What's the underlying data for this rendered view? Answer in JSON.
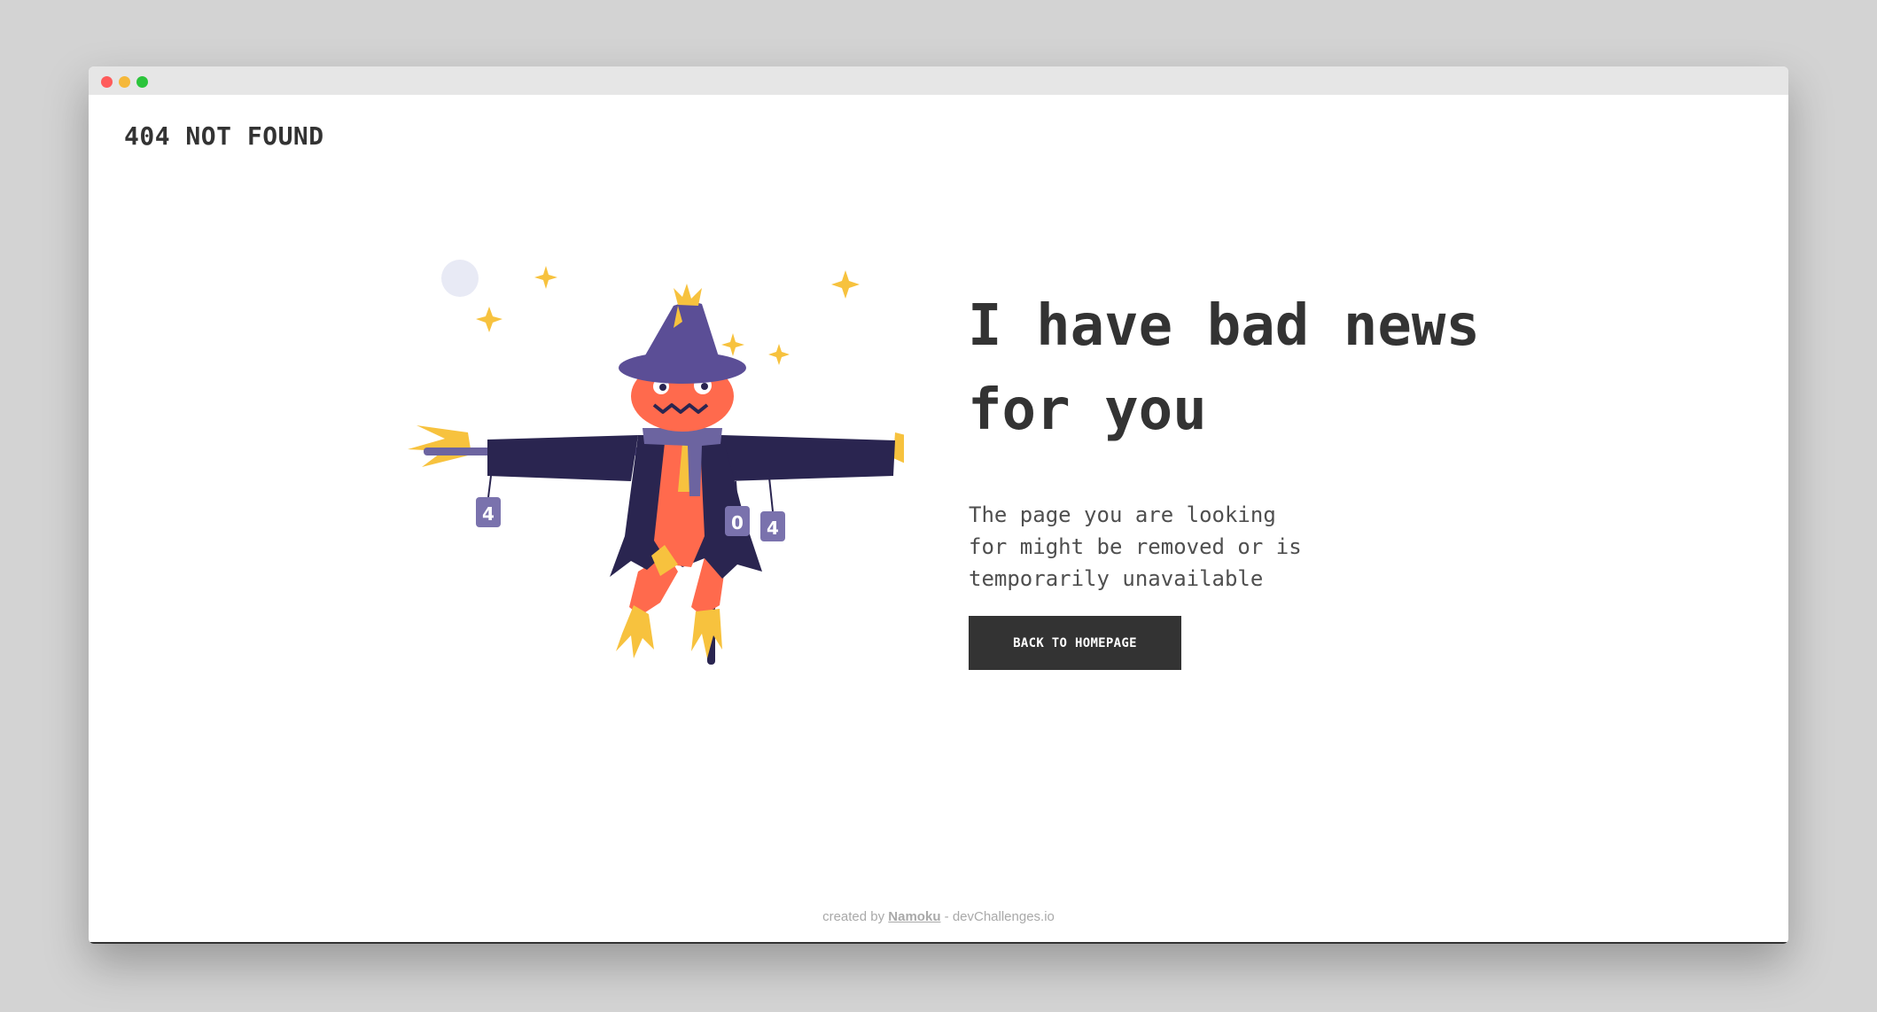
{
  "header": {
    "logo": "404 NOT FOUND"
  },
  "main": {
    "headline_line1": "I have bad news",
    "headline_line2": "for you",
    "message_line1": "The page you are looking",
    "message_line2": "for might be removed or is",
    "message_line3": "temporarily unavailable",
    "button_label": "BACK TO HOMEPAGE"
  },
  "illustration": {
    "can_labels": [
      "4",
      "0",
      "4"
    ],
    "colors": {
      "hat": "#5b4e96",
      "coat": "#2a2550",
      "face": "#ff6a4d",
      "straw": "#f7c23e",
      "scarf": "#6c64a0",
      "can": "#7a72ad",
      "moon": "#e8eaf5",
      "post": "#2a2550"
    }
  },
  "footer": {
    "prefix": "created by",
    "author": "Namoku",
    "suffix": "- devChallenges.io"
  },
  "colors": {
    "background": "#d3d3d3",
    "text_dark": "#333333",
    "button_bg": "#333333",
    "button_text": "#ffffff",
    "footer_text": "#a9a9a9"
  }
}
